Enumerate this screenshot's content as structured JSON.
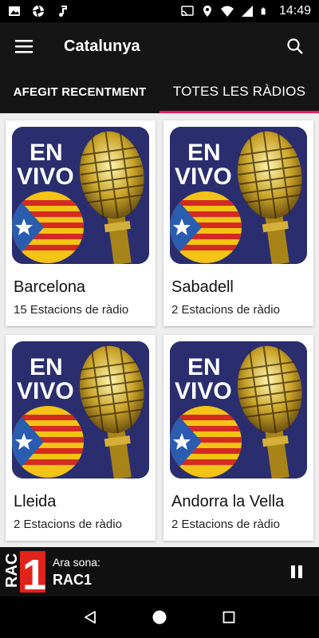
{
  "status_bar": {
    "time": "14:49",
    "icons_left": [
      "photo-icon",
      "aperture-icon",
      "music-note-icon"
    ],
    "icons_right": [
      "cast-icon",
      "location-icon",
      "wifi-icon",
      "signal-icon",
      "battery-icon"
    ]
  },
  "app_bar": {
    "title": "Catalunya",
    "menu_icon": "hamburger-icon",
    "search_icon": "search-icon"
  },
  "tabs": [
    {
      "label": "AFEGIT RECENTMENT",
      "active": false
    },
    {
      "label": "TOTES LES RÀDIOS",
      "active": true
    }
  ],
  "accent_color": "#e91e63",
  "cards": [
    {
      "title": "Barcelona",
      "subtitle": "15 Estacions de ràdio",
      "badge_line1": "EN",
      "badge_line2": "VIVO"
    },
    {
      "title": "Sabadell",
      "subtitle": "2 Estacions de ràdio",
      "badge_line1": "EN",
      "badge_line2": "VIVO"
    },
    {
      "title": "Lleida",
      "subtitle": "2 Estacions de ràdio",
      "badge_line1": "EN",
      "badge_line2": "VIVO"
    },
    {
      "title": "Andorra la Vella",
      "subtitle": "2 Estacions de ràdio",
      "badge_line1": "EN",
      "badge_line2": "VIVO"
    }
  ],
  "player": {
    "logo_text_1": "RAC",
    "logo_text_2": "1",
    "label": "Ara sona:",
    "station": "RAC1",
    "control_icon": "pause-icon"
  },
  "nav_bar": {
    "icons": [
      "back-icon",
      "home-icon",
      "recents-icon"
    ]
  }
}
